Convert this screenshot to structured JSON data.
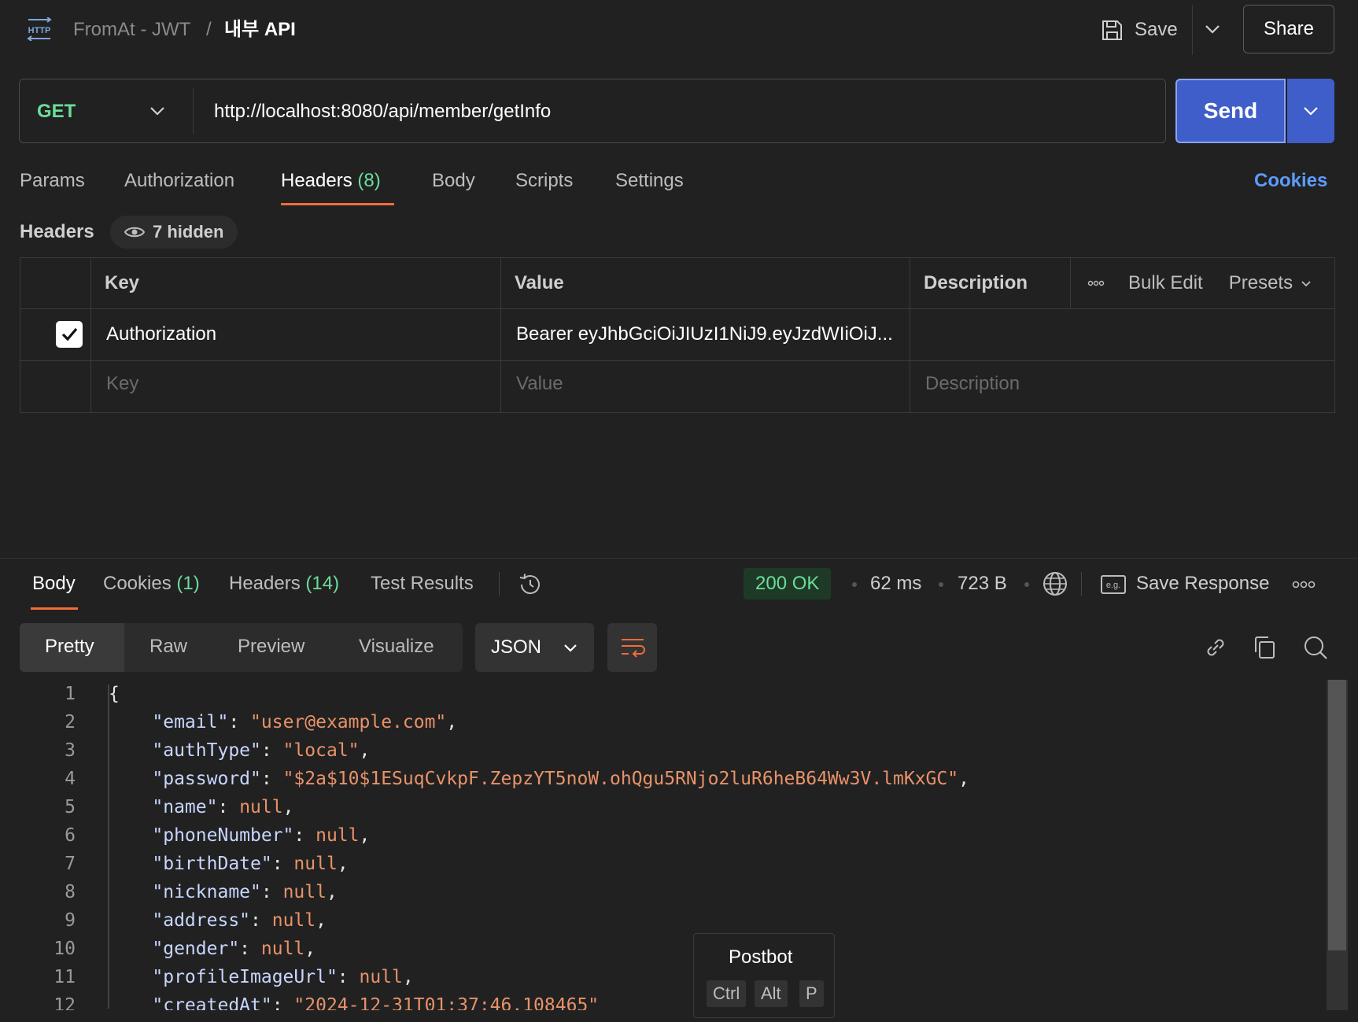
{
  "breadcrumb": {
    "collection": "FromAt - JWT",
    "separator": "/",
    "request_name": "내부 API"
  },
  "toolbar": {
    "save_label": "Save",
    "share_label": "Share"
  },
  "request": {
    "method": "GET",
    "url": "http://localhost:8080/api/member/getInfo",
    "send_label": "Send"
  },
  "request_tabs": {
    "params": "Params",
    "authorization": "Authorization",
    "headers": "Headers",
    "headers_count": "(8)",
    "body": "Body",
    "scripts": "Scripts",
    "settings": "Settings",
    "cookies": "Cookies"
  },
  "headers_section": {
    "title": "Headers",
    "hidden": "7 hidden",
    "columns": {
      "key": "Key",
      "value": "Value",
      "description": "Description"
    },
    "bulk_edit": "Bulk Edit",
    "presets": "Presets",
    "row": {
      "key": "Authorization",
      "value": "Bearer eyJhbGciOiJIUzI1NiJ9.eyJzdWIiOiJ..."
    },
    "placeholders": {
      "key": "Key",
      "value": "Value",
      "description": "Description"
    }
  },
  "response_tabs": {
    "body": "Body",
    "cookies": "Cookies",
    "cookies_count": "(1)",
    "headers": "Headers",
    "headers_count": "(14)",
    "test_results": "Test Results"
  },
  "response_meta": {
    "status": "200 OK",
    "time": "62 ms",
    "size": "723 B",
    "save_response": "Save Response"
  },
  "body_views": {
    "pretty": "Pretty",
    "raw": "Raw",
    "preview": "Preview",
    "visualize": "Visualize",
    "format": "JSON"
  },
  "code_lines": [
    {
      "n": "1",
      "parts": [
        {
          "t": "p",
          "v": "{"
        }
      ]
    },
    {
      "n": "2",
      "parts": [
        {
          "t": "p",
          "v": "    "
        },
        {
          "t": "k",
          "v": "\"email\""
        },
        {
          "t": "p",
          "v": ": "
        },
        {
          "t": "s",
          "v": "\"user@example.com\""
        },
        {
          "t": "p",
          "v": ","
        }
      ]
    },
    {
      "n": "3",
      "parts": [
        {
          "t": "p",
          "v": "    "
        },
        {
          "t": "k",
          "v": "\"authType\""
        },
        {
          "t": "p",
          "v": ": "
        },
        {
          "t": "s",
          "v": "\"local\""
        },
        {
          "t": "p",
          "v": ","
        }
      ]
    },
    {
      "n": "4",
      "parts": [
        {
          "t": "p",
          "v": "    "
        },
        {
          "t": "k",
          "v": "\"password\""
        },
        {
          "t": "p",
          "v": ": "
        },
        {
          "t": "s",
          "v": "\"$2a$10$1ESuqCvkpF.ZepzYT5noW.ohQgu5RNjo2luR6heB64Ww3V.lmKxGC\""
        },
        {
          "t": "p",
          "v": ","
        }
      ]
    },
    {
      "n": "5",
      "parts": [
        {
          "t": "p",
          "v": "    "
        },
        {
          "t": "k",
          "v": "\"name\""
        },
        {
          "t": "p",
          "v": ": "
        },
        {
          "t": "n",
          "v": "null"
        },
        {
          "t": "p",
          "v": ","
        }
      ]
    },
    {
      "n": "6",
      "parts": [
        {
          "t": "p",
          "v": "    "
        },
        {
          "t": "k",
          "v": "\"phoneNumber\""
        },
        {
          "t": "p",
          "v": ": "
        },
        {
          "t": "n",
          "v": "null"
        },
        {
          "t": "p",
          "v": ","
        }
      ]
    },
    {
      "n": "7",
      "parts": [
        {
          "t": "p",
          "v": "    "
        },
        {
          "t": "k",
          "v": "\"birthDate\""
        },
        {
          "t": "p",
          "v": ": "
        },
        {
          "t": "n",
          "v": "null"
        },
        {
          "t": "p",
          "v": ","
        }
      ]
    },
    {
      "n": "8",
      "parts": [
        {
          "t": "p",
          "v": "    "
        },
        {
          "t": "k",
          "v": "\"nickname\""
        },
        {
          "t": "p",
          "v": ": "
        },
        {
          "t": "n",
          "v": "null"
        },
        {
          "t": "p",
          "v": ","
        }
      ]
    },
    {
      "n": "9",
      "parts": [
        {
          "t": "p",
          "v": "    "
        },
        {
          "t": "k",
          "v": "\"address\""
        },
        {
          "t": "p",
          "v": ": "
        },
        {
          "t": "n",
          "v": "null"
        },
        {
          "t": "p",
          "v": ","
        }
      ]
    },
    {
      "n": "10",
      "parts": [
        {
          "t": "p",
          "v": "    "
        },
        {
          "t": "k",
          "v": "\"gender\""
        },
        {
          "t": "p",
          "v": ": "
        },
        {
          "t": "n",
          "v": "null"
        },
        {
          "t": "p",
          "v": ","
        }
      ]
    },
    {
      "n": "11",
      "parts": [
        {
          "t": "p",
          "v": "    "
        },
        {
          "t": "k",
          "v": "\"profileImageUrl\""
        },
        {
          "t": "p",
          "v": ": "
        },
        {
          "t": "n",
          "v": "null"
        },
        {
          "t": "p",
          "v": ","
        }
      ]
    },
    {
      "n": "12",
      "parts": [
        {
          "t": "p",
          "v": "    "
        },
        {
          "t": "k",
          "v": "\"createdAt\""
        },
        {
          "t": "p",
          "v": ": "
        },
        {
          "t": "s",
          "v": "\"2024-12-31T01:37:46.108465\""
        }
      ]
    }
  ],
  "postbot": {
    "title": "Postbot",
    "keys": [
      "Ctrl",
      "Alt",
      "P"
    ]
  },
  "colors": {
    "accent": "#f26b3a",
    "send": "#3f5ec9",
    "success": "#6bdd9a",
    "link": "#5d9bff"
  },
  "icons": [
    "http-icon",
    "save-icon",
    "chevron-down-icon",
    "eye-icon",
    "check-icon",
    "more-icon",
    "history-icon",
    "globe-icon",
    "save-response-icon",
    "wrap-icon",
    "link-icon",
    "copy-icon",
    "search-icon"
  ]
}
